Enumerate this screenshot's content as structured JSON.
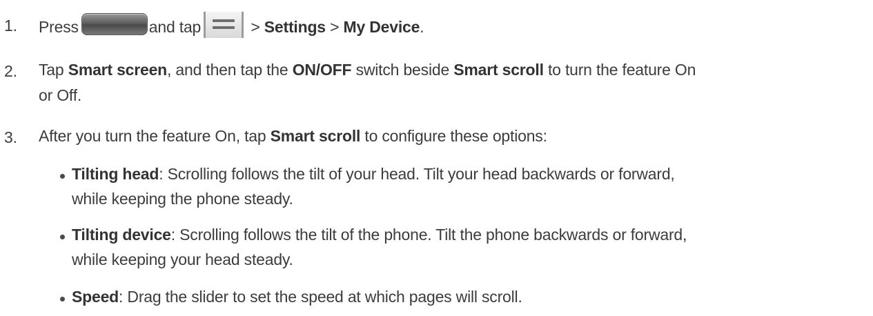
{
  "steps": [
    {
      "num": "1.",
      "segments": {
        "t1": "Press",
        "t2": "and tap",
        "t3": " > ",
        "b1": "Settings",
        "t4": " > ",
        "b2": "My Device",
        "t5": "."
      }
    },
    {
      "num": "2.",
      "segments": {
        "t1": "Tap ",
        "b1": "Smart screen",
        "t2": ", and then tap the ",
        "b2": "ON/OFF",
        "t3": " switch beside ",
        "b3": "Smart scroll",
        "t4": " to turn the feature On",
        "line2": "or Off."
      }
    },
    {
      "num": "3.",
      "segments": {
        "t1": "After you turn the feature On, tap ",
        "b1": "Smart scroll",
        "t2": " to configure these options:"
      }
    }
  ],
  "bullets": [
    {
      "term": "Tilting head",
      "line1": ": Scrolling follows the tilt of your head. Tilt your head backwards or forward,",
      "line2": "while keeping the phone steady."
    },
    {
      "term": "Tilting device",
      "line1": ": Scrolling follows the tilt of the phone. Tilt the phone backwards or forward,",
      "line2": "while keeping your head steady."
    },
    {
      "term": "Speed",
      "line1": ": Drag the slider to set the speed at which pages will scroll."
    }
  ],
  "icons": {
    "home_key": "home-key-icon",
    "menu_key": "menu-key-icon"
  }
}
